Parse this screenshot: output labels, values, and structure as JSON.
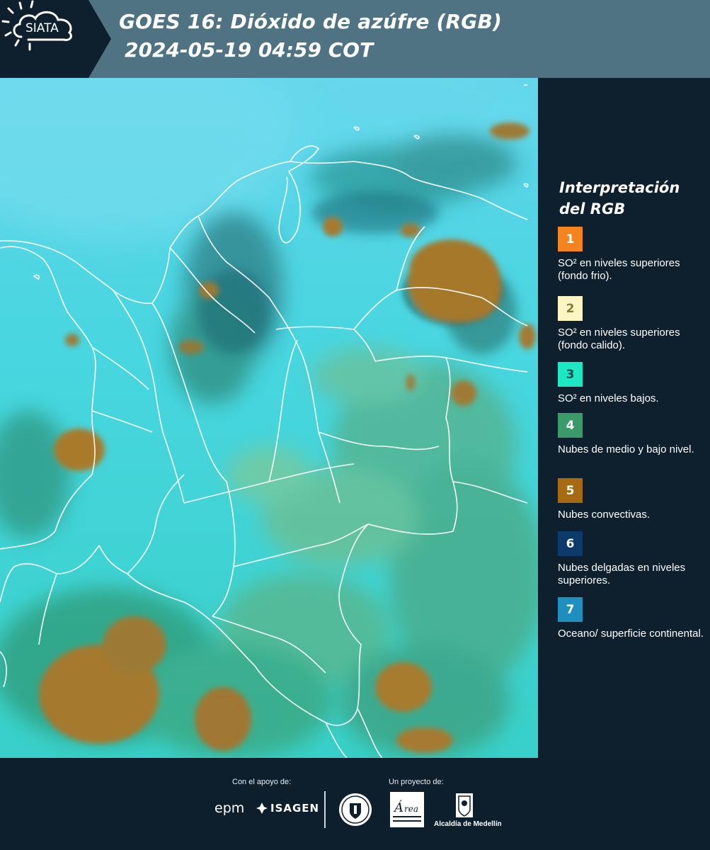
{
  "header": {
    "brand": "SIATA",
    "title_line1": "GOES 16: Dióxido de azúfre (RGB)",
    "title_line2": "2024-05-19 04:59 COT",
    "colors": {
      "bar": "#4f7383",
      "dark": "#0e202d"
    }
  },
  "map": {
    "base_color": "#3fd3de",
    "icon": "satellite-rgb-image"
  },
  "legend": {
    "title": "Interpretación del RGB",
    "items": [
      {
        "num": "1",
        "color": "#f5841f",
        "numColor": "#ffffff",
        "text": "SO² en niveles superiores (fondo frio)."
      },
      {
        "num": "2",
        "color": "#fdf6c3",
        "numColor": "#8a7a3a",
        "text": "SO² en niveles superiores (fondo calido)."
      },
      {
        "num": "3",
        "color": "#1ee8c4",
        "numColor": "#0e4a4a",
        "text": "SO² en niveles bajos."
      },
      {
        "num": "4",
        "color": "#3a9a6a",
        "numColor": "#ffffff",
        "text": "Nubes de medio y bajo nivel."
      },
      {
        "num": "5",
        "color": "#a56a12",
        "numColor": "#ffffff",
        "text": "Nubes convectivas."
      },
      {
        "num": "6",
        "color": "#0c3a6b",
        "numColor": "#ffffff",
        "text": "Nubes delgadas en niveles superiores."
      },
      {
        "num": "7",
        "color": "#1e8fbe",
        "numColor": "#ffffff",
        "text": "Oceano/ superficie continental."
      }
    ]
  },
  "footer": {
    "support_label": "Con el apoyo de:",
    "project_label": "Un proyecto de:",
    "epm": "epm",
    "isagen": "ISAGEN",
    "alcaldia": "Alcaldía de Medellín",
    "area_logo": "Área Metropolitana logo",
    "seal": "Medellín seal"
  }
}
